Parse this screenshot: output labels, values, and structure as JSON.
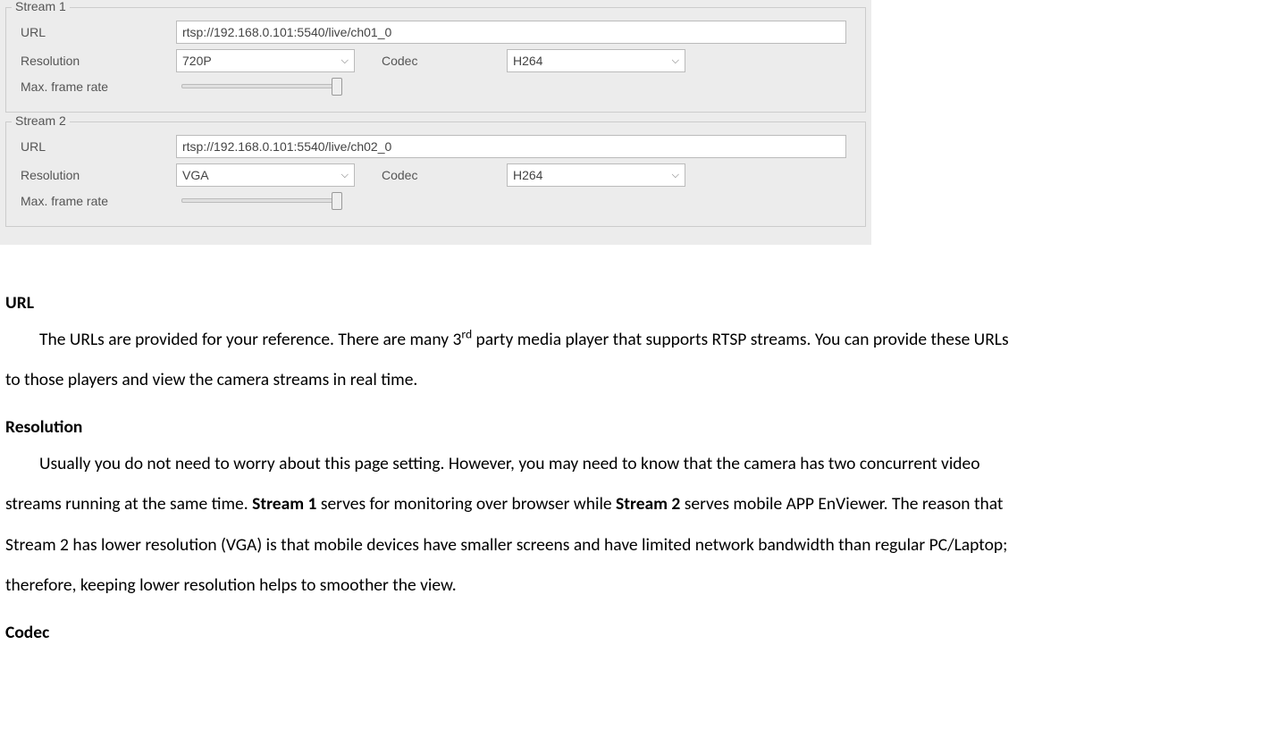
{
  "streams": [
    {
      "legend": "Stream 1",
      "url_label": "URL",
      "url_value": "rtsp://192.168.0.101:5540/live/ch01_0",
      "resolution_label": "Resolution",
      "resolution_value": "720P",
      "codec_label": "Codec",
      "codec_value": "H264",
      "frame_label": "Max. frame rate"
    },
    {
      "legend": "Stream 2",
      "url_label": "URL",
      "url_value": "rtsp://192.168.0.101:5540/live/ch02_0",
      "resolution_label": "Resolution",
      "resolution_value": "VGA",
      "codec_label": "Codec",
      "codec_value": "H264",
      "frame_label": "Max. frame rate"
    }
  ],
  "doc": {
    "url_heading": "URL",
    "url_p1a": "The URLs are provided for your reference. There are many 3",
    "url_sup": "rd",
    "url_p1b": " party media player that supports RTSP streams. You can provide these URLs",
    "url_p2": "to those players and view the camera streams in real time.",
    "res_heading": "Resolution",
    "res_p1": "Usually you do not need to worry about this page setting. However, you may need to know that the camera has two concurrent video",
    "res_p2a": "streams running at the same time. ",
    "res_s1": "Stream 1",
    "res_p2b": " serves for monitoring over browser while ",
    "res_s2": "Stream 2",
    "res_p2c": " serves mobile APP EnViewer. The reason that",
    "res_p3": "Stream 2 has lower resolution (VGA) is that mobile devices have smaller screens and have limited network bandwidth than regular PC/Laptop;",
    "res_p4": "therefore, keeping lower resolution helps to smoother the view.",
    "codec_heading": "Codec"
  }
}
